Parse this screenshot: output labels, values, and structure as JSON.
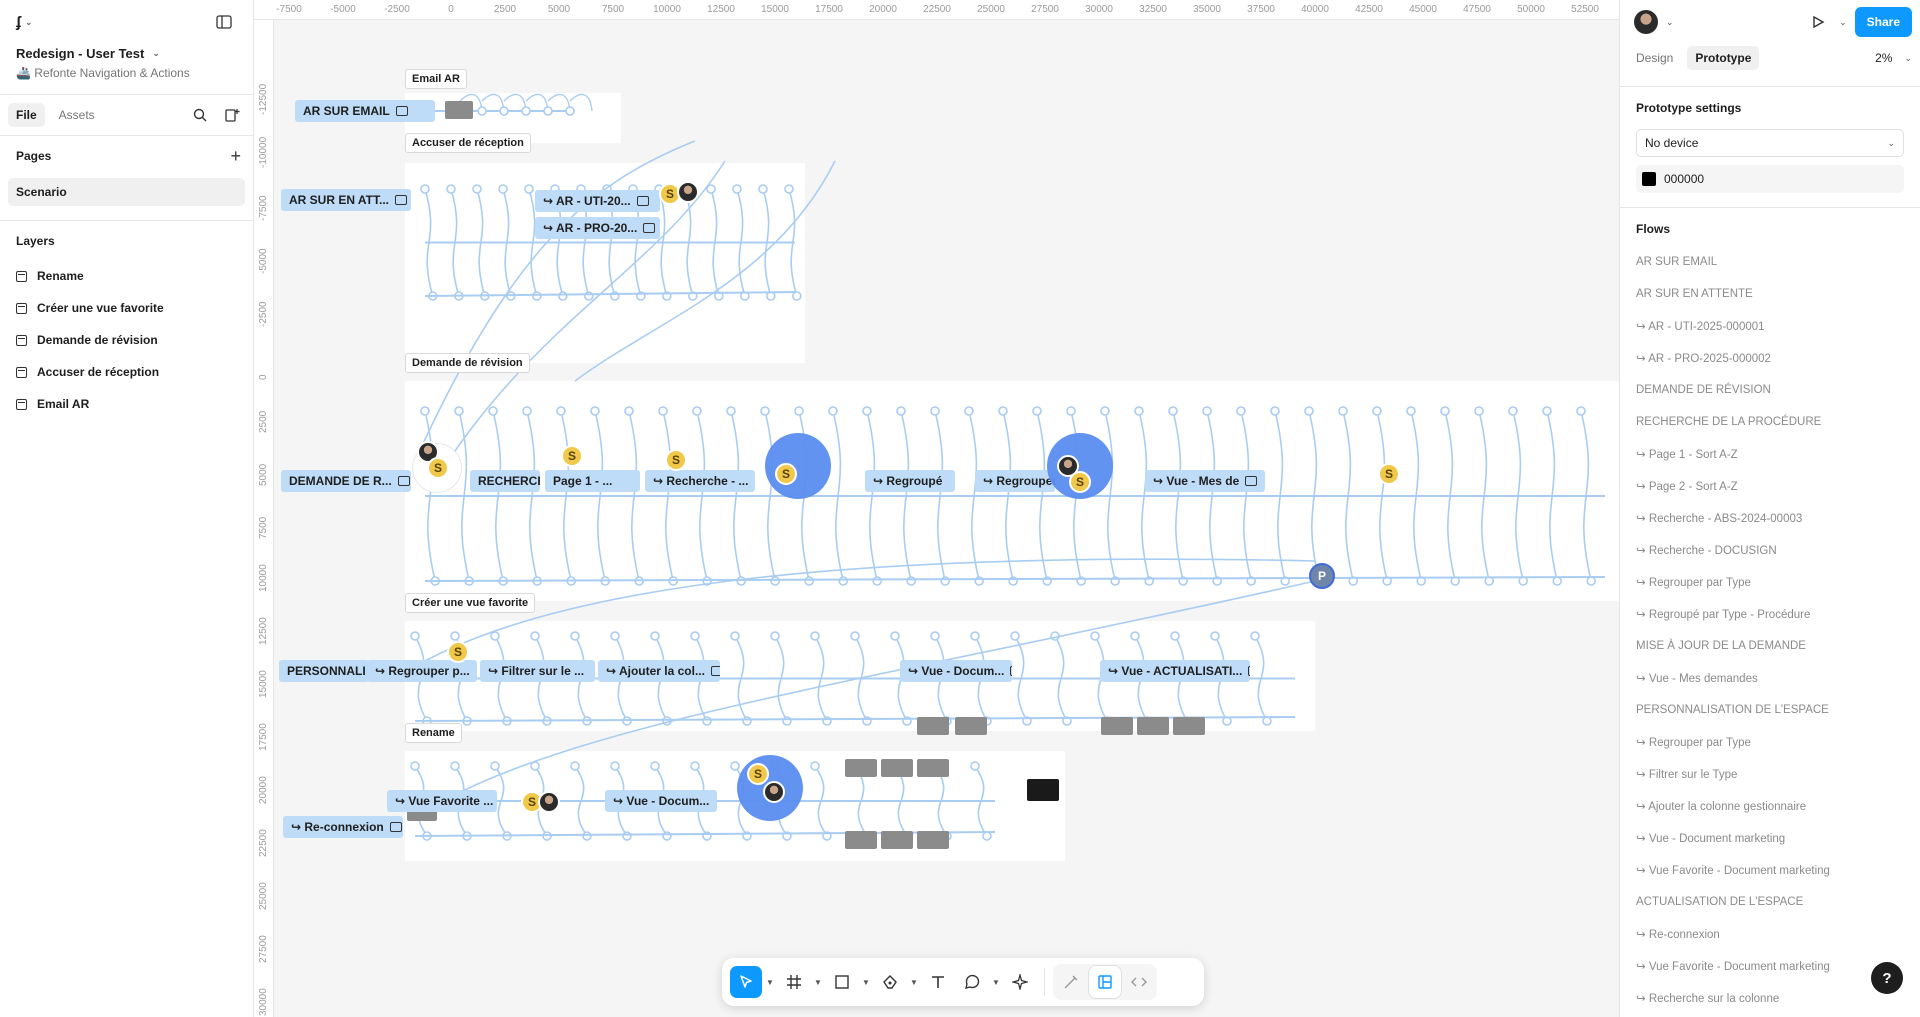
{
  "app": {
    "logo_glyph": "ʄ",
    "caret": "⌄"
  },
  "file": {
    "title": "Redesign - User Test",
    "subtitle": "🚢 Refonte Navigation & Actions"
  },
  "left_tabs": [
    {
      "label": "File"
    },
    {
      "label": "Assets"
    }
  ],
  "pages": {
    "heading": "Pages",
    "items": [
      "Scenario"
    ]
  },
  "layers": {
    "heading": "Layers",
    "items": [
      "Rename",
      "Créer une vue favorite",
      "Demande de révision",
      "Accuser de réception",
      "Email AR"
    ]
  },
  "ruler": {
    "x_ticks": [
      "-7500",
      "-5000",
      "-2500",
      "0",
      "2500",
      "5000",
      "7500",
      "10000",
      "12500",
      "15000",
      "17500",
      "20000",
      "22500",
      "25000",
      "27500",
      "30000",
      "32500",
      "35000",
      "37500",
      "40000",
      "42500",
      "45000",
      "47500",
      "50000",
      "52500",
      "55"
    ],
    "y_ticks": [
      "-12500",
      "-10000",
      "-7500",
      "-5000",
      "-2500",
      "0",
      "2500",
      "5000",
      "7500",
      "10000",
      "12500",
      "15000",
      "17500",
      "20000",
      "22500",
      "25000",
      "27500",
      "30000"
    ]
  },
  "canvas": {
    "flow_labels": [
      "AR SUR EMAIL",
      "AR SUR EN ATT...",
      "DEMANDE DE R...",
      "PERSONNALI",
      "↪ Re-connexion",
      "↪ AR - UTI-20...",
      "↪ AR - PRO-20...",
      "↪ Regrouper p...",
      "↪ Filtrer sur le ...",
      "↪ Ajouter la col...",
      "↪ Vue - Docum...",
      "↪ Vue - ACTUALISATI...",
      "↪ Vue Favorite ...",
      "↪ Regrouper",
      "↪ Vue - Mes de",
      "RECHERCHE",
      "Page 1 - ...",
      "↪ Recherche - ...",
      "↪ Regroupé",
      "↪ Vue - Docum..."
    ],
    "frame_labels": [
      "Email AR",
      "Accuser de réception",
      "Demande de révision",
      "Créer une vue favorite",
      "Rename"
    ],
    "avatar_s": "S",
    "avatar_p": "P"
  },
  "toolbar": {
    "tools": [
      "move-tool",
      "frame-tool",
      "shape-tool",
      "pen-tool",
      "text-tool",
      "comment-tool",
      "actions-tool",
      "draw-mode",
      "design-mode",
      "dev-mode"
    ]
  },
  "right": {
    "share": "Share",
    "tabs": [
      {
        "label": "Design"
      },
      {
        "label": "Prototype"
      }
    ],
    "zoom": "2%",
    "settings_heading": "Prototype settings",
    "device": "No device",
    "bg_color_hex": "000000",
    "flows_heading": "Flows",
    "flows": [
      "AR SUR EMAIL",
      "AR SUR EN ATTENTE",
      "↪ AR - UTI-2025-000001",
      "↪ AR - PRO-2025-000002",
      "DEMANDE DE RÉVISION",
      "RECHERCHE DE LA PROCÉDURE",
      "↪ Page 1 - Sort A-Z",
      "↪ Page 2 - Sort A-Z",
      "↪ Recherche - ABS-2024-00003",
      "↪ Recherche - DOCUSIGN",
      "↪ Regrouper par Type",
      "↪ Regroupé par Type - Procédure",
      "MISE À JOUR DE LA DEMANDE",
      "↪ Vue - Mes demandes",
      "PERSONNALISATION DE L'ESPACE",
      "↪ Regrouper par Type",
      "↪ Filtrer sur le Type",
      "↪ Ajouter la colonne gestionnaire",
      "↪ Vue - Document marketing",
      "↪ Vue Favorite - Document marketing",
      "ACTUALISATION DE L'ESPACE",
      "↪ Re-connexion",
      "↪ Vue Favorite - Document marketing",
      "↪ Recherche sur la colonne"
    ],
    "help": "?"
  },
  "colors": {
    "accent": "#0d99ff",
    "flow_label": "#bedcf7",
    "connector": "#a9cdf2",
    "avatar_s": "#f0c84a"
  }
}
